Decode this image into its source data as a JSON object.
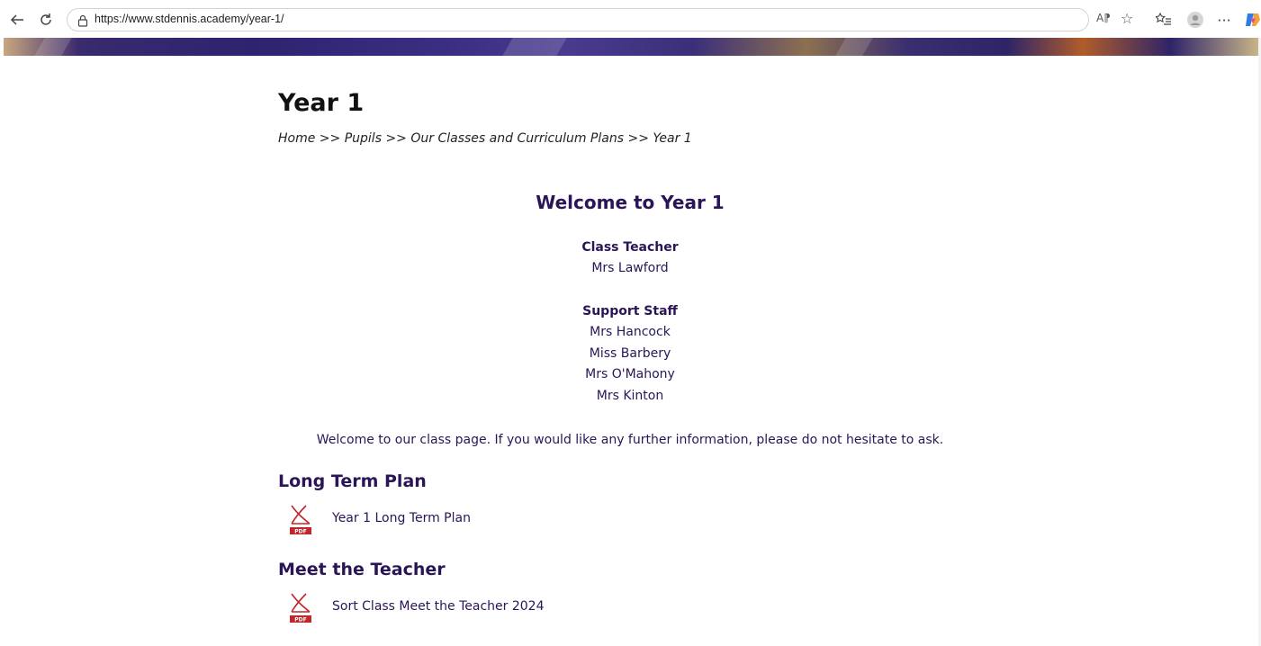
{
  "browser": {
    "url": "https://www.stdennis.academy/year-1/",
    "read_aloud_icon": "read-aloud-icon"
  },
  "page": {
    "title": "Year 1",
    "breadcrumb": {
      "home": "Home",
      "sep": ">>",
      "pupils": "Pupils",
      "classes": "Our Classes and Curriculum Plans",
      "current": "Year 1"
    },
    "welcome_heading": "Welcome to Year 1",
    "class_teacher_label": "Class Teacher",
    "class_teacher": "Mrs Lawford",
    "support_staff_label": "Support Staff",
    "support_staff": [
      "Mrs Hancock",
      "Miss Barbery",
      "Mrs O'Mahony",
      "Mrs Kinton"
    ],
    "intro_text": "Welcome to our class page. If you would like any further information, please do not hesitate to ask.",
    "sections": [
      {
        "heading": "Long Term Plan",
        "document": "Year 1 Long Term Plan",
        "icon": "pdf-icon"
      },
      {
        "heading": "Meet the Teacher",
        "document": "Sort Class Meet the Teacher 2024",
        "icon": "pdf-icon"
      }
    ]
  },
  "colors": {
    "heading_purple": "#2a1557",
    "pdf_red": "#c0272d"
  }
}
